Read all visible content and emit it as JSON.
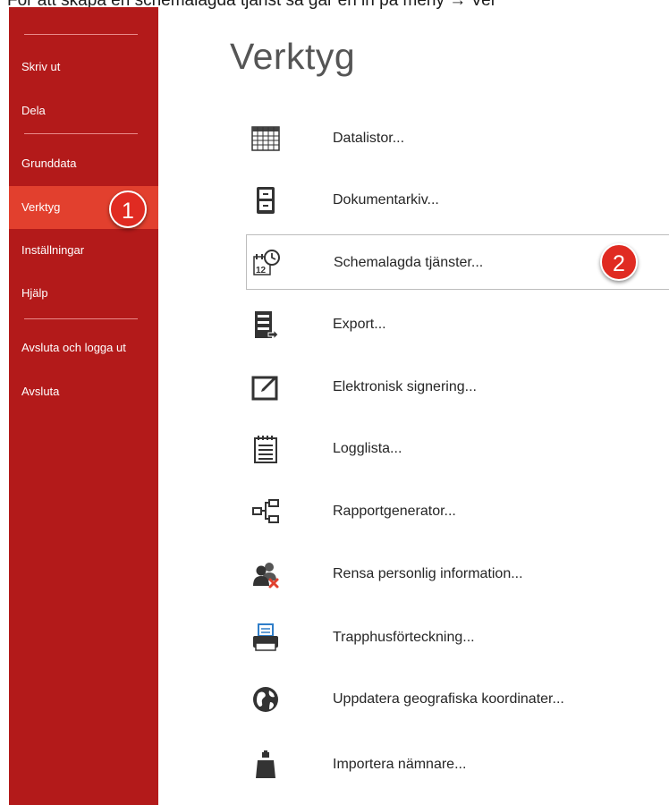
{
  "caption": "För att skapa en schemalagda tjänst så går en in på meny → Ver",
  "sidebar": {
    "items": [
      {
        "label": "Skriv ut"
      },
      {
        "label": "Dela"
      },
      {
        "label": "Grunddata"
      },
      {
        "label": "Verktyg",
        "active": true
      },
      {
        "label": "Inställningar"
      },
      {
        "label": "Hjälp"
      },
      {
        "label": "Avsluta och logga ut"
      },
      {
        "label": "Avsluta"
      }
    ]
  },
  "badges": {
    "step1": "1",
    "step2": "2"
  },
  "colors": {
    "sidebar": "#b31a1a",
    "active": "#e2402e",
    "badge": "#e02b22"
  },
  "page": {
    "title": "Verktyg"
  },
  "tools": [
    {
      "label": "Datalistor...",
      "icon": "table-icon"
    },
    {
      "label": "Dokumentarkiv...",
      "icon": "archive-icon"
    },
    {
      "label": "Schemalagda tjänster...",
      "icon": "schedule-clock-icon",
      "selected": true
    },
    {
      "label": "Export...",
      "icon": "export-server-icon"
    },
    {
      "label": "Elektronisk signering...",
      "icon": "sign-pen-icon"
    },
    {
      "label": "Logglista...",
      "icon": "notepad-icon"
    },
    {
      "label": "Rapportgenerator...",
      "icon": "hierarchy-icon"
    },
    {
      "label": "Rensa personlig information...",
      "icon": "remove-users-icon"
    },
    {
      "label": "Trapphusförteckning...",
      "icon": "printer-icon"
    },
    {
      "label": "Uppdatera geografiska koordinater...",
      "icon": "globe-icon"
    },
    {
      "label": "Importera nämnare...",
      "icon": "weight-icon"
    }
  ]
}
